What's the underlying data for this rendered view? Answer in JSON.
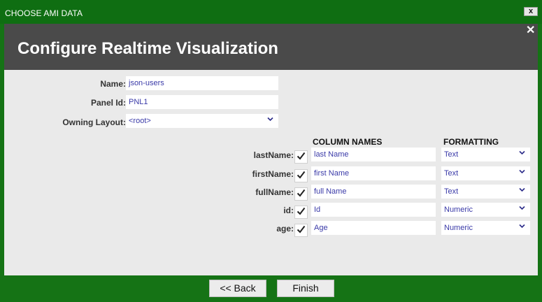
{
  "window": {
    "title": "CHOOSE AMI DATA",
    "close_glyph": "x"
  },
  "dialog": {
    "title": "Configure Realtime Visualization",
    "close_glyph": "✕"
  },
  "form": {
    "name": {
      "label": "Name:",
      "value": "json-users"
    },
    "panel_id": {
      "label": "Panel Id:",
      "value": "PNL1"
    },
    "owning_layout": {
      "label": "Owning Layout:",
      "value": "<root>"
    }
  },
  "columns": {
    "header_names": "COLUMN NAMES",
    "header_formatting": "FORMATTING",
    "rows": [
      {
        "field": "lastName:",
        "checked": true,
        "name": "last Name",
        "format": "Text"
      },
      {
        "field": "firstName:",
        "checked": true,
        "name": "first Name",
        "format": "Text"
      },
      {
        "field": "fullName:",
        "checked": true,
        "name": "full Name",
        "format": "Text"
      },
      {
        "field": "id:",
        "checked": true,
        "name": "Id",
        "format": "Numeric"
      },
      {
        "field": "age:",
        "checked": true,
        "name": "Age",
        "format": "Numeric"
      }
    ]
  },
  "footer": {
    "back_label": "<< Back",
    "finish_label": "Finish"
  },
  "colors": {
    "titlebar_green": "#0f6e12",
    "header_gray": "#4a4a4a",
    "body_gray": "#eaeaea",
    "value_text": "#3a3aa8"
  },
  "icons": {
    "checkbox": "check-icon",
    "dropdown": "chevron-down-icon",
    "close": "close-icon"
  }
}
